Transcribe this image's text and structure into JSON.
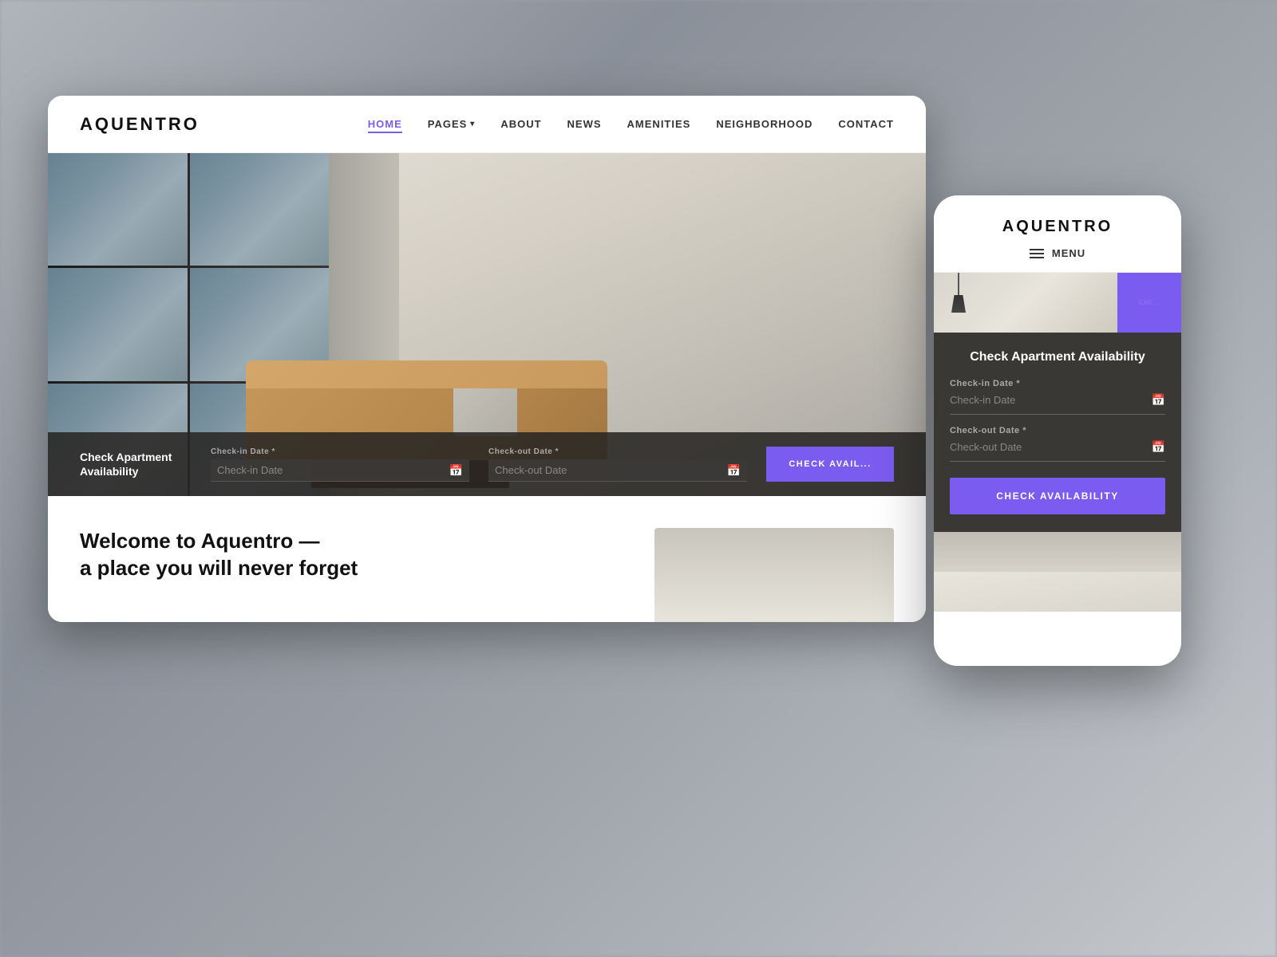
{
  "background": {
    "color": "#9aa0a8"
  },
  "desktop": {
    "logo": "AQUENTRO",
    "nav": {
      "links": [
        {
          "id": "home",
          "label": "HOME",
          "active": true
        },
        {
          "id": "pages",
          "label": "PAGES",
          "hasDropdown": true
        },
        {
          "id": "about",
          "label": "ABOUT",
          "active": false
        },
        {
          "id": "news",
          "label": "NEWS",
          "active": false
        },
        {
          "id": "amenities",
          "label": "AMENITIES",
          "active": false
        },
        {
          "id": "neighborhood",
          "label": "NEIGHBORHOOD",
          "active": false
        },
        {
          "id": "contact",
          "label": "CONTACT",
          "active": false
        }
      ]
    },
    "booking": {
      "title_line1": "Check Apartment",
      "title_line2": "Availability",
      "checkin_label": "Check-in Date *",
      "checkin_placeholder": "Check-in Date",
      "checkout_label": "Check-out Date *",
      "checkout_placeholder": "Check-out Date",
      "button_label": "CHECK AVAIL..."
    },
    "welcome": {
      "headline_line1": "Welcome to Aquentro —",
      "headline_line2": "a place you will never forget"
    }
  },
  "mobile": {
    "logo": "AQUENTRO",
    "menu_label": "MENU",
    "booking": {
      "title": "Check Apartment Availability",
      "checkin_label": "Check-in Date *",
      "checkin_placeholder": "Check-in Date",
      "checkout_label": "Check-out Date *",
      "checkout_placeholder": "Check-out Date",
      "button_label": "CHECK AVAILABILITY"
    },
    "hero_button": "CHE..."
  },
  "colors": {
    "brand_purple": "#7b5cf0",
    "dark_overlay": "rgba(40,38,35,0.88)",
    "booking_bg": "#3a3835",
    "nav_active": "#7b5cf0"
  }
}
